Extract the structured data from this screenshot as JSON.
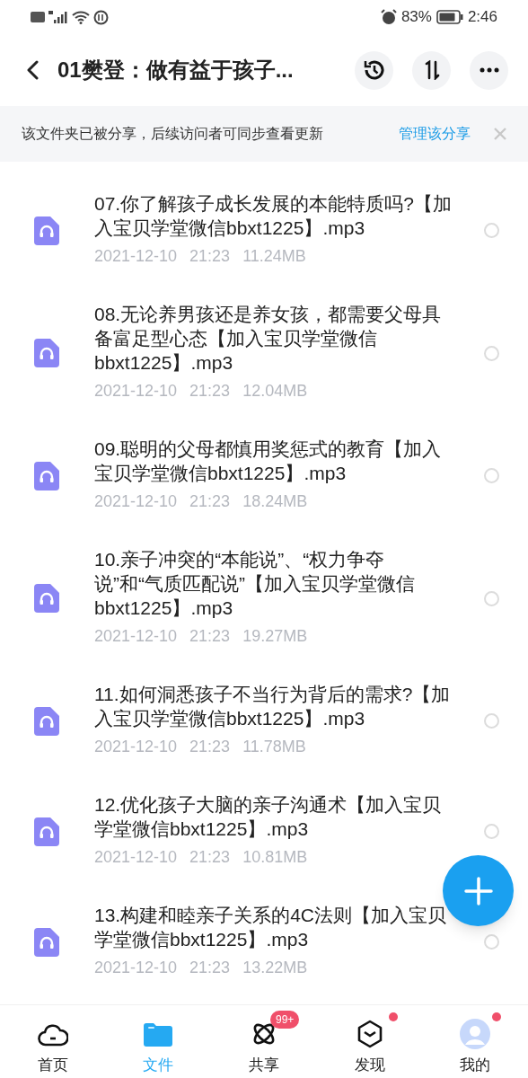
{
  "status_bar": {
    "battery": "83%",
    "time": "2:46"
  },
  "header": {
    "title": "01樊登：做有益于孩子..."
  },
  "share_banner": {
    "text": "该文件夹已被分享，后续访问者可同步查看更新",
    "action": "管理该分享"
  },
  "files": [
    {
      "name": "07.你了解孩子成长发展的本能特质吗?【加入宝贝学堂微信bbxt1225】.mp3",
      "date": "2021-12-10",
      "time": "21:23",
      "size": "11.24MB",
      "selected": false
    },
    {
      "name": "08.无论养男孩还是养女孩，都需要父母具备富足型心态【加入宝贝学堂微信bbxt1225】.mp3",
      "date": "2021-12-10",
      "time": "21:23",
      "size": "12.04MB",
      "selected": false
    },
    {
      "name": "09.聪明的父母都慎用奖惩式的教育【加入宝贝学堂微信bbxt1225】.mp3",
      "date": "2021-12-10",
      "time": "21:23",
      "size": "18.24MB",
      "selected": false
    },
    {
      "name": "10.亲子冲突的“本能说”、“权力争夺说”和“气质匹配说”【加入宝贝学堂微信bbxt1225】.mp3",
      "date": "2021-12-10",
      "time": "21:23",
      "size": "19.27MB",
      "selected": false
    },
    {
      "name": "11.如何洞悉孩子不当行为背后的需求?【加入宝贝学堂微信bbxt1225】.mp3",
      "date": "2021-12-10",
      "time": "21:23",
      "size": "11.78MB",
      "selected": false
    },
    {
      "name": "12.优化孩子大脑的亲子沟通术【加入宝贝学堂微信bbxt1225】.mp3",
      "date": "2021-12-10",
      "time": "21:23",
      "size": "10.81MB",
      "selected": false
    },
    {
      "name": "13.构建和睦亲子关系的4C法则【加入宝贝学堂微信bbxt1225】.mp3",
      "date": "2021-12-10",
      "time": "21:23",
      "size": "13.22MB",
      "selected": false
    }
  ],
  "bottom_nav": [
    {
      "kind": "cloud",
      "label": "首页",
      "selected": false
    },
    {
      "kind": "folder",
      "label": "文件",
      "selected": true
    },
    {
      "kind": "atom",
      "label": "共享",
      "selected": false,
      "badge": "99+"
    },
    {
      "kind": "cube",
      "label": "发现",
      "selected": false,
      "dot": true
    },
    {
      "kind": "avatar",
      "label": "我的",
      "selected": false,
      "dot": true
    }
  ]
}
